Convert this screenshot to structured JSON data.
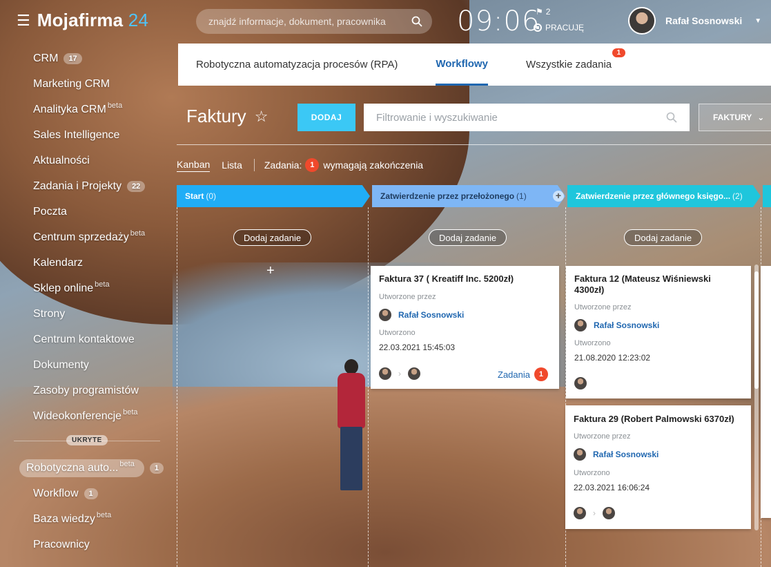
{
  "app": {
    "name": "Mojafirma",
    "name_suffix": "24"
  },
  "sidebar": {
    "items": [
      {
        "label": "CRM",
        "counter": "17"
      },
      {
        "label": "Marketing CRM"
      },
      {
        "label": "Analityka CRM",
        "sup": "beta"
      },
      {
        "label": "Sales Intelligence"
      },
      {
        "label": "Aktualności"
      },
      {
        "label": "Zadania i Projekty",
        "counter": "22"
      },
      {
        "label": "Poczta"
      },
      {
        "label": "Centrum sprzedaży",
        "sup": "beta"
      },
      {
        "label": "Kalendarz"
      },
      {
        "label": "Sklep online",
        "sup": "beta"
      },
      {
        "label": "Strony"
      },
      {
        "label": "Centrum kontaktowe"
      },
      {
        "label": "Dokumenty"
      },
      {
        "label": "Zasoby programistów"
      },
      {
        "label": "Wideokonferencje",
        "sup": "beta"
      }
    ],
    "hidden_label": "UKRYTE",
    "hidden_items": [
      {
        "label": "Robotyczna auto...",
        "sup": "beta",
        "counter": "1",
        "active": true
      },
      {
        "label": "Workflow",
        "counter": "1"
      },
      {
        "label": "Baza wiedzy",
        "sup": "beta"
      },
      {
        "label": "Pracownicy"
      }
    ]
  },
  "header": {
    "search_placeholder": "znajdź informacje, dokument, pracownika",
    "time": "09:06",
    "flag_count": "2",
    "status": "PRACUJĘ",
    "user_name": "Rafał Sosnowski"
  },
  "tabs": [
    {
      "label": "Robotyczna automatyzacja procesów (RPA)"
    },
    {
      "label": "Workflowy",
      "active": true
    },
    {
      "label": "Wszystkie zadania",
      "badge": "1"
    }
  ],
  "page": {
    "title": "Faktury",
    "add_button": "DODAJ",
    "filter_placeholder": "Filtrowanie i wyszukiwanie",
    "dropdown_label": "FAKTURY",
    "views": [
      "Kanban",
      "Lista"
    ],
    "tasks_label": "Zadania:",
    "tasks_count": "1",
    "tasks_text": "wymagają zakończenia"
  },
  "kanban": {
    "add_task_label": "Dodaj zadanie",
    "columns": [
      {
        "title": "Start",
        "count": "(0)",
        "color": "#20adf6"
      },
      {
        "title": "Zatwierdzenie przez przełożonego",
        "count": "(1)",
        "color": "#7eb6f5"
      },
      {
        "title": "Zatwierdzenie przez głównego księgo...",
        "count": "(2)",
        "color": "#1fc6dc"
      }
    ],
    "cards": [
      {
        "title": "Faktura 37 ( Kreatiff Inc. 5200zł)",
        "created_by_label": "Utworzone przez",
        "user": "Rafał Sosnowski",
        "created_label": "Utworzono",
        "date": "22.03.2021 15:45:03",
        "tasks_label": "Zadania",
        "tasks_count": "1"
      },
      {
        "title": "Faktura 12 (Mateusz Wiśniewski 4300zł)",
        "created_by_label": "Utworzone przez",
        "user": "Rafał Sosnowski",
        "created_label": "Utworzono",
        "date": "21.08.2020 12:23:02"
      },
      {
        "title": "Faktura 29 (Robert Palmowski 6370zł)",
        "created_by_label": "Utworzone przez",
        "user": "Rafał Sosnowski",
        "created_label": "Utworzono",
        "date": "22.03.2021 16:06:24"
      }
    ]
  },
  "colors": {
    "accent": "#3bc8f5",
    "link": "#2067b0",
    "badge": "#f0492c"
  }
}
